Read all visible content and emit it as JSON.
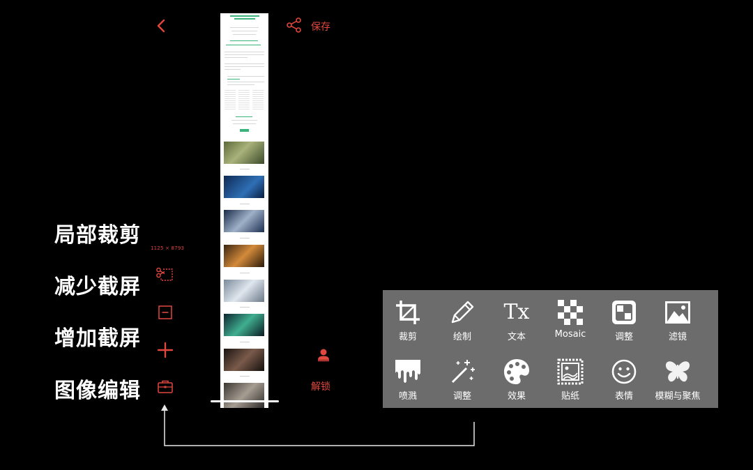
{
  "header": {
    "save_label": "保存",
    "back_icon": "chevron-left-icon",
    "share_icon": "share-icon"
  },
  "preview": {
    "dimensions": "1125 × 8793"
  },
  "side_tools": [
    {
      "name": "crop-scissors-icon",
      "label": "局部裁剪"
    },
    {
      "name": "minus-square-icon",
      "label": "减少截屏"
    },
    {
      "name": "plus-icon",
      "label": "增加截屏"
    },
    {
      "name": "toolbox-icon",
      "label": "图像编辑"
    }
  ],
  "unlock": {
    "label": "解锁",
    "icon": "person-icon"
  },
  "edit_panel": {
    "items": [
      {
        "label": "裁剪",
        "icon": "crop-icon"
      },
      {
        "label": "绘制",
        "icon": "pencil-icon"
      },
      {
        "label": "文本",
        "icon": "text-tx-icon",
        "glyph": "Tx"
      },
      {
        "label": "Mosaic",
        "icon": "mosaic-icon"
      },
      {
        "label": "调整",
        "icon": "adjust-square-icon"
      },
      {
        "label": "滤镜",
        "icon": "image-filter-icon"
      },
      {
        "label": "喷溅",
        "icon": "drip-icon"
      },
      {
        "label": "调整",
        "icon": "magic-wand-icon"
      },
      {
        "label": "效果",
        "icon": "palette-icon"
      },
      {
        "label": "贴纸",
        "icon": "stamp-icon"
      },
      {
        "label": "表情",
        "icon": "smiley-icon"
      },
      {
        "label": "模糊与聚焦",
        "icon": "butterfly-icon"
      }
    ]
  },
  "colors": {
    "accent": "#e0473e",
    "background": "#000000",
    "panel": "#6c6c6c"
  }
}
